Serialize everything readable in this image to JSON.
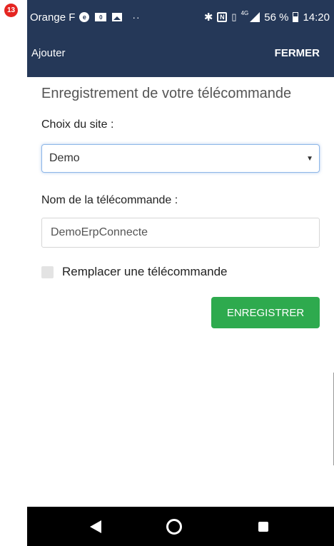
{
  "step_badge": "13",
  "status_bar": {
    "carrier": "Orange F",
    "battery": "56 %",
    "time": "14:20",
    "network": "4G",
    "icons": [
      "notification-icon",
      "card-icon",
      "image-icon",
      "more-dots-icon",
      "bluetooth-icon",
      "nfc-icon",
      "vibrate-icon",
      "signal-icon",
      "battery-icon"
    ]
  },
  "app_bar": {
    "title": "Ajouter",
    "close_label": "FERMER"
  },
  "form": {
    "page_title": "Enregistrement de votre télécommande",
    "site_label": "Choix du site :",
    "site_value": "Demo",
    "name_label": "Nom de la télécommande :",
    "name_value": "DemoErpConnecte",
    "replace_label": "Remplacer une télécommande",
    "replace_checked": false,
    "save_label": "ENREGISTRER"
  },
  "nav_bar": {
    "buttons": [
      "back",
      "home",
      "recent-apps"
    ]
  },
  "colors": {
    "header": "#253858",
    "save_button": "#2eaa4e",
    "badge": "#e52521",
    "focus_border": "#8eb7e8"
  }
}
